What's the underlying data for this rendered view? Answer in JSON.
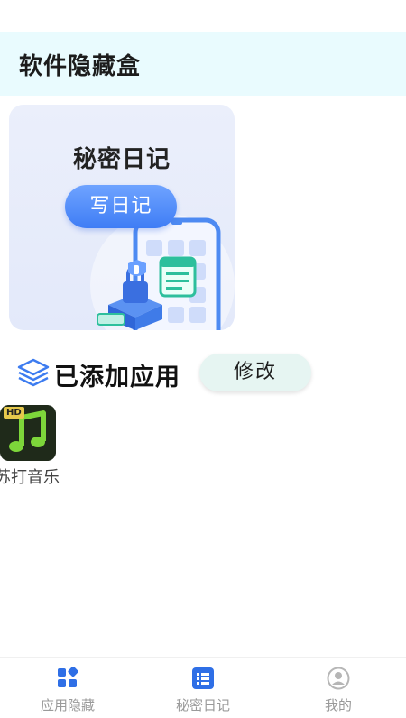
{
  "header": {
    "title": "软件隐藏盒"
  },
  "diary_card": {
    "title": "秘密日记",
    "button_label": "写日记"
  },
  "added_section": {
    "title": "已添加应用",
    "edit_label": "修改"
  },
  "apps": [
    {
      "name": "苏打音乐",
      "badge": "HD",
      "icon": "music-note-icon"
    }
  ],
  "tabbar": {
    "items": [
      {
        "label": "应用隐藏",
        "icon": "grid-icon"
      },
      {
        "label": "秘密日记",
        "icon": "list-icon"
      },
      {
        "label": "我的",
        "icon": "user-icon"
      }
    ]
  },
  "colors": {
    "header_bg": "#e9fbfe",
    "accent_blue": "#3f7df5",
    "tab_active": "#2f6fe6",
    "tab_inactive": "#b6b6b6",
    "music_green": "#7dd63a"
  }
}
